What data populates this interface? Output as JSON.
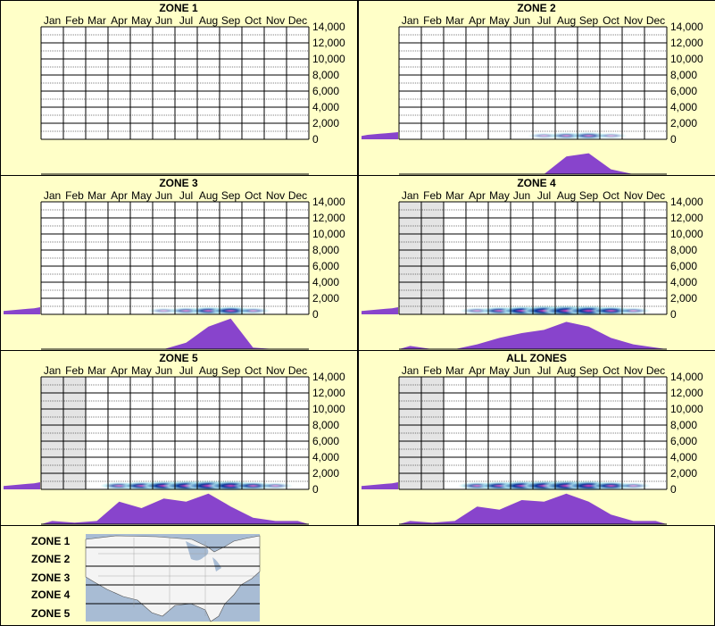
{
  "colors": {
    "background": "#ffffc8",
    "plot_background": "#ffffff",
    "shaded_months": "#e4e4e4",
    "area_fill": "#8844cc",
    "heat_low": "#aee8f0",
    "heat_mid": "#0a3a9a",
    "heat_high": "#e040c0"
  },
  "chart_data": [
    {
      "type": "heatmap",
      "title": "ZONE 1",
      "categories": [
        "Jan",
        "Feb",
        "Mar",
        "Apr",
        "May",
        "Jun",
        "Jul",
        "Aug",
        "Sep",
        "Oct",
        "Nov",
        "Dec"
      ],
      "y_ticks": [
        "14,000",
        "12,000",
        "10,000",
        "8,000",
        "6,000",
        "4,000",
        "2,000",
        "0"
      ],
      "ylim": [
        0,
        14000
      ],
      "shaded_months": [],
      "left_distribution": [],
      "heat_band": [],
      "seasonal_area": []
    },
    {
      "type": "heatmap",
      "title": "ZONE 2",
      "categories": [
        "Jan",
        "Feb",
        "Mar",
        "Apr",
        "May",
        "Jun",
        "Jul",
        "Aug",
        "Sep",
        "Oct",
        "Nov",
        "Dec"
      ],
      "y_ticks": [
        "14,000",
        "12,000",
        "10,000",
        "8,000",
        "6,000",
        "4,000",
        "2,000",
        "0"
      ],
      "ylim": [
        0,
        14000
      ],
      "shaded_months": [],
      "left_distribution": [
        0.3,
        0.5,
        0.6,
        0.7,
        0.8,
        0.9,
        1.0
      ],
      "heat_band": [
        0,
        0,
        0,
        0,
        0,
        0,
        0.1,
        0.3,
        0.4,
        0.1,
        0,
        0
      ],
      "seasonal_area": [
        0,
        0,
        0,
        0,
        0,
        0,
        0,
        0.55,
        0.65,
        0.15,
        0,
        0
      ]
    },
    {
      "type": "heatmap",
      "title": "ZONE 3",
      "categories": [
        "Jan",
        "Feb",
        "Mar",
        "Apr",
        "May",
        "Jun",
        "Jul",
        "Aug",
        "Sep",
        "Oct",
        "Nov",
        "Dec"
      ],
      "y_ticks": [
        "14,000",
        "12,000",
        "10,000",
        "8,000",
        "6,000",
        "4,000",
        "2,000",
        "0"
      ],
      "ylim": [
        0,
        14000
      ],
      "shaded_months": [],
      "left_distribution": [
        0.3,
        0.4,
        0.5,
        0.6,
        0.7,
        0.8,
        1.0
      ],
      "heat_band": [
        0,
        0,
        0,
        0,
        0,
        0.1,
        0.3,
        0.5,
        0.6,
        0.2,
        0,
        0
      ],
      "seasonal_area": [
        0,
        0,
        0,
        0,
        0,
        0,
        0.2,
        0.7,
        0.95,
        0.05,
        0,
        0
      ]
    },
    {
      "type": "heatmap",
      "title": "ZONE 4",
      "categories": [
        "Jan",
        "Feb",
        "Mar",
        "Apr",
        "May",
        "Jun",
        "Jul",
        "Aug",
        "Sep",
        "Oct",
        "Nov",
        "Dec"
      ],
      "y_ticks": [
        "14,000",
        "12,000",
        "10,000",
        "8,000",
        "6,000",
        "4,000",
        "2,000",
        "0"
      ],
      "ylim": [
        0,
        14000
      ],
      "shaded_months": [
        "Jan",
        "Feb"
      ],
      "left_distribution": [
        0.3,
        0.4,
        0.5,
        0.6,
        0.7,
        0.8,
        1.0
      ],
      "heat_band": [
        0,
        0,
        0,
        0.2,
        0.5,
        0.7,
        0.9,
        1.0,
        0.9,
        0.6,
        0.2,
        0
      ],
      "seasonal_area": [
        0.1,
        0,
        0,
        0.15,
        0.35,
        0.5,
        0.6,
        0.85,
        0.7,
        0.35,
        0.15,
        0.05
      ]
    },
    {
      "type": "heatmap",
      "title": "ZONE 5",
      "categories": [
        "Jan",
        "Feb",
        "Mar",
        "Apr",
        "May",
        "Jun",
        "Jul",
        "Aug",
        "Sep",
        "Oct",
        "Nov",
        "Dec"
      ],
      "y_ticks": [
        "14,000",
        "12,000",
        "10,000",
        "8,000",
        "6,000",
        "4,000",
        "2,000",
        "0"
      ],
      "ylim": [
        0,
        14000
      ],
      "shaded_months": [
        "Jan",
        "Feb"
      ],
      "left_distribution": [
        0.3,
        0.4,
        0.5,
        0.6,
        0.7,
        0.8,
        1.0
      ],
      "heat_band": [
        0,
        0,
        0,
        0.4,
        0.6,
        0.8,
        0.9,
        1.0,
        0.9,
        0.5,
        0.2,
        0
      ],
      "seasonal_area": [
        0.1,
        0.05,
        0.1,
        0.7,
        0.5,
        0.8,
        0.7,
        0.95,
        0.55,
        0.2,
        0.1,
        0.1
      ]
    },
    {
      "type": "heatmap",
      "title": "ALL ZONES",
      "categories": [
        "Jan",
        "Feb",
        "Mar",
        "Apr",
        "May",
        "Jun",
        "Jul",
        "Aug",
        "Sep",
        "Oct",
        "Nov",
        "Dec"
      ],
      "y_ticks": [
        "14,000",
        "12,000",
        "10,000",
        "8,000",
        "6,000",
        "4,000",
        "2,000",
        "0"
      ],
      "ylim": [
        0,
        14000
      ],
      "shaded_months": [
        "Jan",
        "Feb"
      ],
      "left_distribution": [
        0.3,
        0.4,
        0.5,
        0.6,
        0.7,
        0.8,
        1.0
      ],
      "heat_band": [
        0,
        0,
        0,
        0.4,
        0.6,
        0.8,
        0.9,
        1.0,
        0.9,
        0.6,
        0.2,
        0
      ],
      "seasonal_area": [
        0.1,
        0.05,
        0.1,
        0.55,
        0.45,
        0.75,
        0.7,
        0.95,
        0.7,
        0.3,
        0.1,
        0.1
      ]
    }
  ],
  "legend": {
    "zones": [
      "ZONE 1",
      "ZONE 2",
      "ZONE 3",
      "ZONE 4",
      "ZONE 5"
    ],
    "map_icon": "us-map-icon"
  }
}
